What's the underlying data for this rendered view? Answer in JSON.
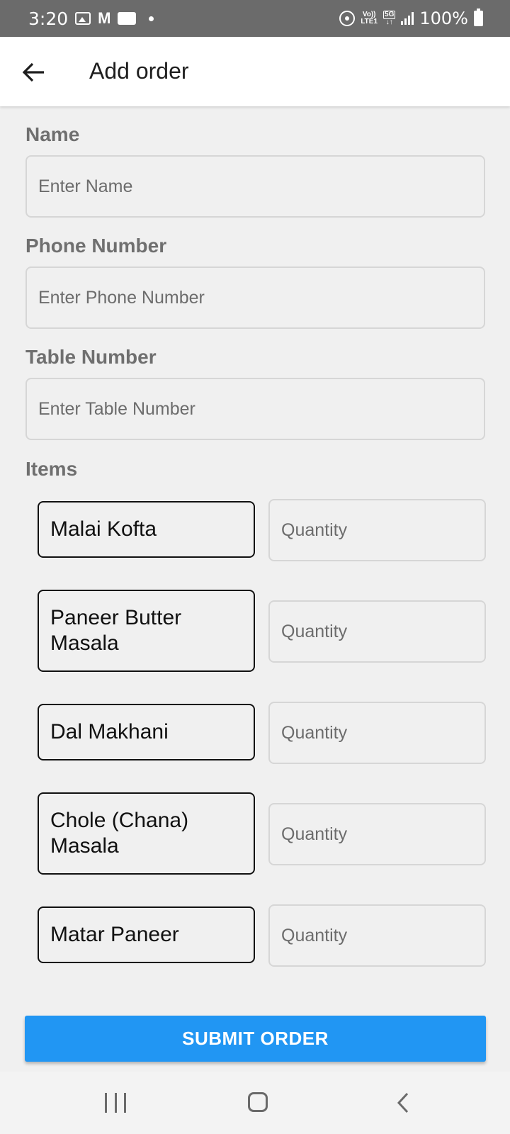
{
  "status_bar": {
    "time": "3:20",
    "battery": "100%",
    "network_top": "Vo))",
    "network_bottom": "LTE1",
    "gen": "5G"
  },
  "app_bar": {
    "title": "Add order"
  },
  "form": {
    "name": {
      "label": "Name",
      "placeholder": "Enter Name",
      "value": ""
    },
    "phone": {
      "label": "Phone Number",
      "placeholder": "Enter Phone Number",
      "value": ""
    },
    "table": {
      "label": "Table Number",
      "placeholder": "Enter Table Number",
      "value": ""
    },
    "items_label": "Items",
    "items": [
      {
        "name": "Malai Kofta",
        "qty_placeholder": "Quantity"
      },
      {
        "name": "Paneer Butter Masala",
        "qty_placeholder": "Quantity"
      },
      {
        "name": "Dal Makhani",
        "qty_placeholder": "Quantity"
      },
      {
        "name": "Chole (Chana) Masala",
        "qty_placeholder": "Quantity"
      },
      {
        "name": "Matar Paneer",
        "qty_placeholder": "Quantity"
      }
    ],
    "submit_label": "SUBMIT ORDER"
  },
  "colors": {
    "status_bar": "#6b6b6b",
    "primary": "#2196f3",
    "background": "#f0f0f0"
  }
}
